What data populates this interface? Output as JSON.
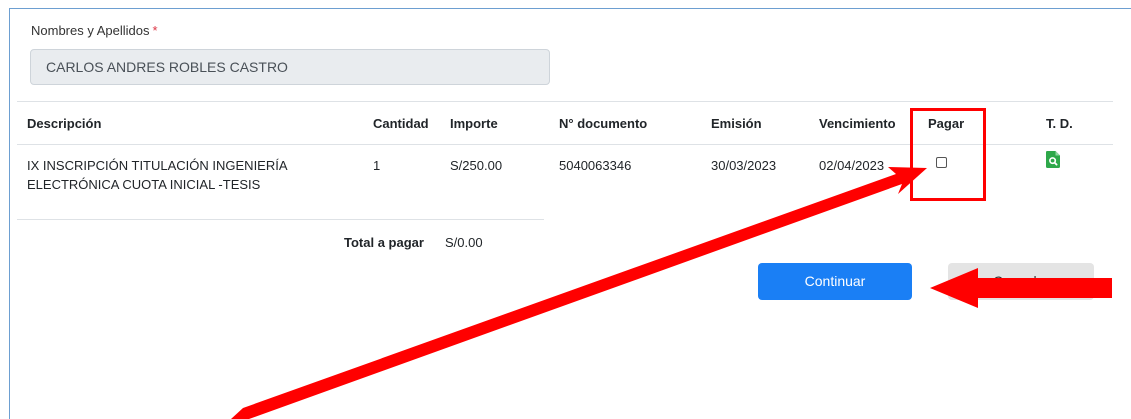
{
  "form": {
    "name_label": "Nombres y Apellidos",
    "required_mark": "*",
    "name_value": "CARLOS ANDRES ROBLES CASTRO"
  },
  "table": {
    "headers": {
      "descripcion": "Descripción",
      "cantidad": "Cantidad",
      "importe": "Importe",
      "documento": "N° documento",
      "emision": "Emisión",
      "vencimiento": "Vencimiento",
      "pagar": "Pagar",
      "td": "T. D."
    },
    "rows": [
      {
        "descripcion": "IX INSCRIPCIÓN TITULACIÓN INGENIERÍA ELECTRÓNICA CUOTA INICIAL -TESIS",
        "cantidad": "1",
        "importe": "S/250.00",
        "documento": "5040063346",
        "emision": "30/03/2023",
        "vencimiento": "02/04/2023",
        "pagar_checked": false,
        "td_icon": "document-search-icon"
      }
    ]
  },
  "totals": {
    "label": "Total a pagar",
    "value": "S/0.00"
  },
  "buttons": {
    "continue_label": "Continuar",
    "cancel_label": "Cancelar"
  },
  "colors": {
    "primary": "#1a7ff5",
    "annotation": "#ff0000",
    "icon_green": "#2ea84a"
  }
}
